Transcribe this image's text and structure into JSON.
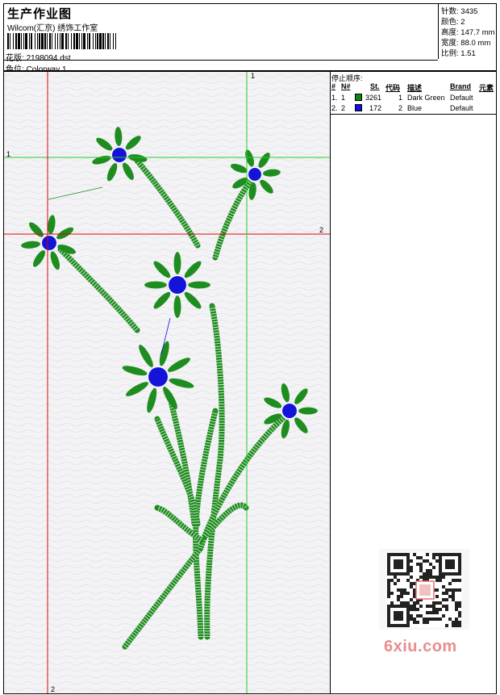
{
  "header": {
    "title": "生产作业图",
    "studio": "Wilcom(汇京) 绣饰工作室",
    "design_label": "花版:",
    "design_value": "2198094.dst",
    "colorway_label": "色位:",
    "colorway_value": "Colorway 1"
  },
  "stats": [
    {
      "label": "针数:",
      "value": "3435"
    },
    {
      "label": "颜色:",
      "value": "2"
    },
    {
      "label": "高度:",
      "value": "147.7 mm"
    },
    {
      "label": "宽度:",
      "value": "88.0 mm"
    },
    {
      "label": "比例:",
      "value": "1.51"
    }
  ],
  "stop_sequence": {
    "title": "停止顺序:",
    "columns": [
      "#",
      "N#",
      "St.",
      "代码",
      "描述",
      "Brand",
      "元素"
    ],
    "rows": [
      {
        "num": "1.",
        "n": "1",
        "stitches": "3261",
        "code": "1",
        "description": "Dark Green",
        "brand": "Default",
        "color": "#0a8a0a"
      },
      {
        "num": "2.",
        "n": "2",
        "stitches": "172",
        "code": "2",
        "description": "Blue",
        "brand": "Default",
        "color": "#1010e0"
      }
    ]
  },
  "guides": {
    "h1": "1",
    "h2": "2",
    "v1": "1",
    "v2": "2"
  },
  "colors": {
    "green": "#1e8c1e",
    "blue": "#1414d8",
    "guide_red": "#e00000",
    "guide_green": "#22cc22"
  },
  "watermark": {
    "text": "6xiu.com"
  }
}
